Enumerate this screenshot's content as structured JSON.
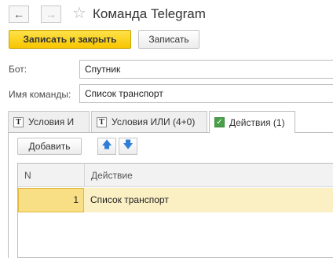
{
  "window": {
    "title": "Команда Telegram"
  },
  "toolbar": {
    "save_close_label": "Записать и закрыть",
    "save_label": "Записать"
  },
  "form": {
    "bot_label": "Бот:",
    "bot_value": "Спутник",
    "command_label": "Имя команды:",
    "command_value": "Список транспорт"
  },
  "tabs": [
    {
      "label": "Условия И"
    },
    {
      "label": "Условия ИЛИ (4+0)"
    },
    {
      "label": "Действия (1)",
      "active": true
    }
  ],
  "actions": {
    "add_label": "Добавить"
  },
  "table": {
    "columns": [
      "N",
      "Действие"
    ],
    "rows": [
      {
        "n": "1",
        "action": "Список транспорт"
      }
    ]
  },
  "colors": {
    "primary_button": "#f7c500",
    "selected_row": "#fbf0c4"
  }
}
